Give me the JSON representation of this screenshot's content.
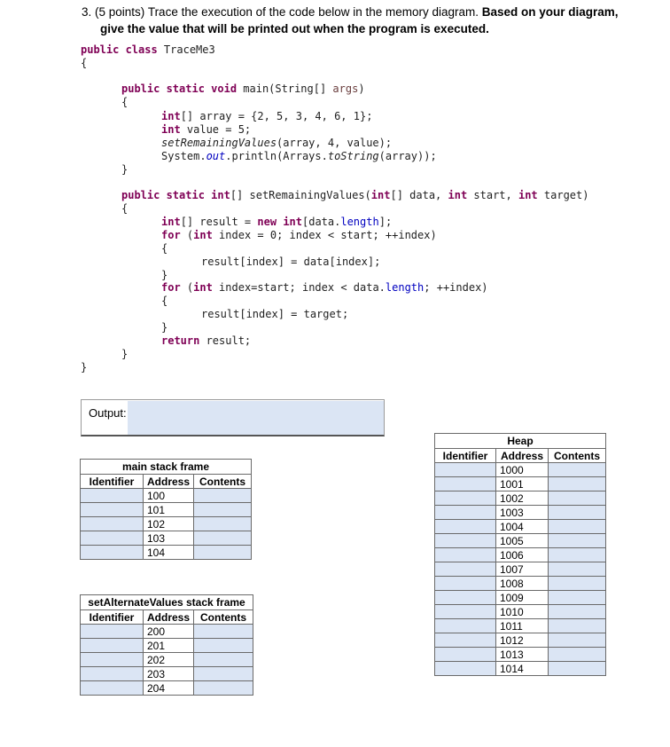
{
  "question": {
    "number": "3.",
    "points": "(5 points)",
    "text_a": " Trace the execution of the code below in the memory diagram. ",
    "text_b": "Based on your diagram,",
    "line2": "give the value that will be printed out when the program is executed."
  },
  "code": {
    "l1_kw": "public class",
    "l1_name": " TraceMe3",
    "l2": "{",
    "l3_kw": "public static void",
    "l3_rest": " main(String[] ",
    "l3_args": "args",
    "l3_end": ")",
    "l4": "{",
    "l5_kw": "int",
    "l5_rest": "[] array = {2, 5, 3, 4, 6, 1};",
    "l6_kw": "int",
    "l6_rest": " value = 5;",
    "l7_call": "setRemainingValues",
    "l7_rest": "(array, 4, value);",
    "l8_a": "System.",
    "l8_out": "out",
    "l8_b": ".println(Arrays.",
    "l8_to": "toString",
    "l8_c": "(array));",
    "l9": "}",
    "l10_kw1": "public static int",
    "l10_a": "[] setRemainingValues(",
    "l10_kw2": "int",
    "l10_b": "[] data, ",
    "l10_kw3": "int",
    "l10_c": " start, ",
    "l10_kw4": "int",
    "l10_d": " target)",
    "l11": "{",
    "l12_kw": "int",
    "l12_a": "[] result = ",
    "l12_new": "new",
    "l12_sp": " ",
    "l12_int": "int",
    "l12_b": "[data.",
    "l12_len": "length",
    "l12_c": "];",
    "l13_for": "for",
    "l13_a": " (",
    "l13_int": "int",
    "l13_b": " index = 0; index < start; ++index)",
    "l14": "{",
    "l15": "result[index] = data[index];",
    "l16": "}",
    "l17_for": "for",
    "l17_a": " (",
    "l17_int": "int",
    "l17_b": " index=start; index < data.",
    "l17_len": "length",
    "l17_c": "; ++index)",
    "l18": "{",
    "l19": "result[index] = target;",
    "l20": "}",
    "l21_kw": "return",
    "l21_rest": " result;",
    "l22": "}",
    "l23": "}"
  },
  "output": {
    "label": "Output:",
    "value": ""
  },
  "main_frame": {
    "title": "main stack frame",
    "headers": [
      "Identifier",
      "Address",
      "Contents"
    ],
    "addresses": [
      "100",
      "101",
      "102",
      "103",
      "104"
    ]
  },
  "set_frame": {
    "title": "setAlternateValues stack frame",
    "headers": [
      "Identifier",
      "Address",
      "Contents"
    ],
    "addresses": [
      "200",
      "201",
      "202",
      "203",
      "204"
    ]
  },
  "heap": {
    "title": "Heap",
    "headers": [
      "Identifier",
      "Address",
      "Contents"
    ],
    "addresses": [
      "1000",
      "1001",
      "1002",
      "1003",
      "1004",
      "1005",
      "1006",
      "1007",
      "1008",
      "1009",
      "1010",
      "1011",
      "1012",
      "1013",
      "1014"
    ]
  },
  "colors": {
    "fill": "#dbe5f4",
    "keyword": "#7f0055",
    "field": "#0000c0"
  }
}
